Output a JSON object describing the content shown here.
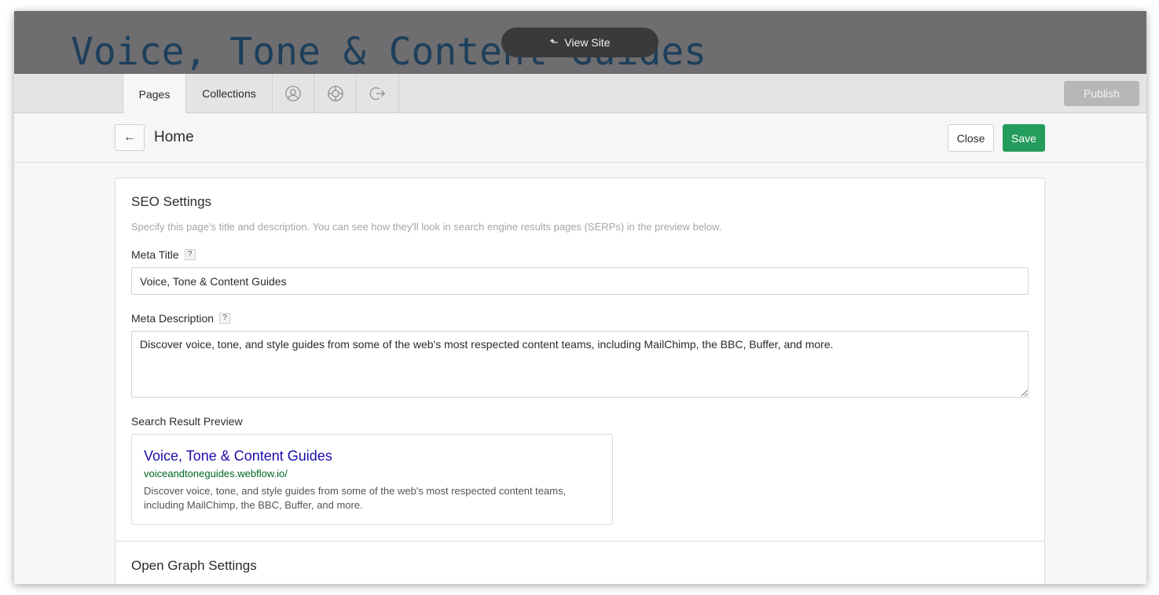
{
  "site": {
    "title": "Voice, Tone & Content Guides",
    "view_site_label": "View Site"
  },
  "tabs": {
    "pages_label": "Pages",
    "collections_label": "Collections",
    "icons": [
      "user-icon",
      "help-lifebuoy-icon",
      "logout-icon"
    ]
  },
  "publish_label": "Publish",
  "page": {
    "name": "Home",
    "close_label": "Close",
    "save_label": "Save"
  },
  "seo": {
    "heading": "SEO Settings",
    "help_text": "Specify this page's title and description. You can see how they'll look in search engine results pages (SERPs) in the preview below.",
    "meta_title_label": "Meta Title",
    "meta_title_value": "Voice, Tone & Content Guides",
    "meta_description_label": "Meta Description",
    "meta_description_value": "Discover voice, tone, and style guides from some of the web's most respected content teams, including MailChimp, the BBC, Buffer, and more.",
    "help_badge": "?",
    "preview_label": "Search Result Preview",
    "preview": {
      "title": "Voice, Tone & Content Guides",
      "url": "voiceandtoneguides.webflow.io/",
      "description": "Discover voice, tone, and style guides from some of the web's most respected content teams, including MailChimp, the BBC, Buffer, and more."
    }
  },
  "open_graph": {
    "heading": "Open Graph Settings"
  },
  "colors": {
    "save": "#249c5b",
    "serp_title": "#1a0dab",
    "serp_url": "#006621"
  }
}
